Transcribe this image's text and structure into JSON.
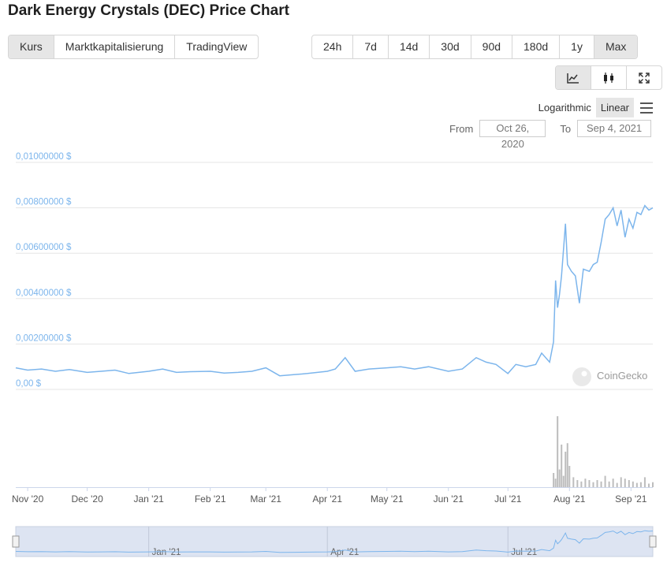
{
  "title": "Dark Energy Crystals (DEC) Price Chart",
  "type_tabs": [
    {
      "label": "Kurs",
      "active": true
    },
    {
      "label": "Marktkapitalisierung",
      "active": false
    },
    {
      "label": "TradingView",
      "active": false
    }
  ],
  "range_tabs": [
    {
      "label": "24h",
      "active": false
    },
    {
      "label": "7d",
      "active": false
    },
    {
      "label": "14d",
      "active": false
    },
    {
      "label": "30d",
      "active": false
    },
    {
      "label": "90d",
      "active": false
    },
    {
      "label": "180d",
      "active": false
    },
    {
      "label": "1y",
      "active": false
    },
    {
      "label": "Max",
      "active": true
    }
  ],
  "tools": [
    {
      "icon": "line-chart-icon",
      "active": true
    },
    {
      "icon": "candlestick-icon",
      "active": false
    },
    {
      "icon": "expand-icon",
      "active": false
    }
  ],
  "scale": {
    "logarithmic": "Logarithmic",
    "linear": "Linear",
    "active": "linear"
  },
  "date_range": {
    "from_label": "From",
    "from": "Oct 26, 2020",
    "to_label": "To",
    "to": "Sep 4, 2021"
  },
  "watermark": "CoinGecko",
  "colors": {
    "line": "#7cb5ec",
    "volume": "#bdbdbd",
    "navigator_fill": "#dde4f2",
    "grid": "#e6e6e6"
  },
  "chart_data": {
    "type": "line",
    "y_ticks": [
      {
        "value": 0.01,
        "label": "0,01000000 $"
      },
      {
        "value": 0.008,
        "label": "0,00800000 $"
      },
      {
        "value": 0.006,
        "label": "0,00600000 $"
      },
      {
        "value": 0.004,
        "label": "0,00400000 $"
      },
      {
        "value": 0.002,
        "label": "0,00200000 $"
      },
      {
        "value": 0,
        "label": "0,00 $"
      }
    ],
    "ylim": [
      0,
      0.01
    ],
    "x_ticks": [
      "Nov '20",
      "Dec '20",
      "Jan '21",
      "Feb '21",
      "Mar '21",
      "Apr '21",
      "May '21",
      "Jun '21",
      "Jul '21",
      "Aug '21",
      "Sep '21"
    ],
    "navigator_ticks": [
      "Jan '21",
      "Apr '21",
      "Jul '21"
    ],
    "series": [
      {
        "values": [
          {
            "x": "2020-10-26",
            "y": 0.00095
          },
          {
            "x": "2020-11-01",
            "y": 0.00085
          },
          {
            "x": "2020-11-08",
            "y": 0.0009
          },
          {
            "x": "2020-11-15",
            "y": 0.0008
          },
          {
            "x": "2020-11-22",
            "y": 0.00088
          },
          {
            "x": "2020-12-01",
            "y": 0.00075
          },
          {
            "x": "2020-12-08",
            "y": 0.0008
          },
          {
            "x": "2020-12-15",
            "y": 0.00085
          },
          {
            "x": "2020-12-22",
            "y": 0.0007
          },
          {
            "x": "2021-01-01",
            "y": 0.0008
          },
          {
            "x": "2021-01-08",
            "y": 0.0009
          },
          {
            "x": "2021-01-15",
            "y": 0.00075
          },
          {
            "x": "2021-01-22",
            "y": 0.00078
          },
          {
            "x": "2021-02-01",
            "y": 0.0008
          },
          {
            "x": "2021-02-08",
            "y": 0.00072
          },
          {
            "x": "2021-02-15",
            "y": 0.00075
          },
          {
            "x": "2021-02-22",
            "y": 0.0008
          },
          {
            "x": "2021-03-01",
            "y": 0.00095
          },
          {
            "x": "2021-03-08",
            "y": 0.0006
          },
          {
            "x": "2021-03-15",
            "y": 0.00065
          },
          {
            "x": "2021-03-22",
            "y": 0.0007
          },
          {
            "x": "2021-04-01",
            "y": 0.0008
          },
          {
            "x": "2021-04-05",
            "y": 0.0009
          },
          {
            "x": "2021-04-10",
            "y": 0.0014
          },
          {
            "x": "2021-04-15",
            "y": 0.0008
          },
          {
            "x": "2021-04-22",
            "y": 0.0009
          },
          {
            "x": "2021-05-01",
            "y": 0.00095
          },
          {
            "x": "2021-05-08",
            "y": 0.001
          },
          {
            "x": "2021-05-15",
            "y": 0.0009
          },
          {
            "x": "2021-05-22",
            "y": 0.001
          },
          {
            "x": "2021-06-01",
            "y": 0.0008
          },
          {
            "x": "2021-06-08",
            "y": 0.0009
          },
          {
            "x": "2021-06-15",
            "y": 0.0014
          },
          {
            "x": "2021-06-20",
            "y": 0.0012
          },
          {
            "x": "2021-06-25",
            "y": 0.0011
          },
          {
            "x": "2021-07-01",
            "y": 0.0007
          },
          {
            "x": "2021-07-05",
            "y": 0.0011
          },
          {
            "x": "2021-07-10",
            "y": 0.001
          },
          {
            "x": "2021-07-15",
            "y": 0.0011
          },
          {
            "x": "2021-07-18",
            "y": 0.0016
          },
          {
            "x": "2021-07-22",
            "y": 0.0012
          },
          {
            "x": "2021-07-24",
            "y": 0.0021
          },
          {
            "x": "2021-07-25",
            "y": 0.0048
          },
          {
            "x": "2021-07-26",
            "y": 0.0036
          },
          {
            "x": "2021-07-27",
            "y": 0.0042
          },
          {
            "x": "2021-07-28",
            "y": 0.005
          },
          {
            "x": "2021-07-30",
            "y": 0.0073
          },
          {
            "x": "2021-07-31",
            "y": 0.0055
          },
          {
            "x": "2021-08-02",
            "y": 0.0052
          },
          {
            "x": "2021-08-04",
            "y": 0.005
          },
          {
            "x": "2021-08-06",
            "y": 0.0038
          },
          {
            "x": "2021-08-08",
            "y": 0.0053
          },
          {
            "x": "2021-08-11",
            "y": 0.0052
          },
          {
            "x": "2021-08-13",
            "y": 0.0055
          },
          {
            "x": "2021-08-15",
            "y": 0.0056
          },
          {
            "x": "2021-08-17",
            "y": 0.0065
          },
          {
            "x": "2021-08-19",
            "y": 0.0075
          },
          {
            "x": "2021-08-21",
            "y": 0.0077
          },
          {
            "x": "2021-08-23",
            "y": 0.008
          },
          {
            "x": "2021-08-25",
            "y": 0.0072
          },
          {
            "x": "2021-08-27",
            "y": 0.0079
          },
          {
            "x": "2021-08-29",
            "y": 0.0067
          },
          {
            "x": "2021-08-31",
            "y": 0.0075
          },
          {
            "x": "2021-09-02",
            "y": 0.0071
          },
          {
            "x": "2021-09-04",
            "y": 0.0078
          },
          {
            "x": "2021-09-06",
            "y": 0.0077
          },
          {
            "x": "2021-09-08",
            "y": 0.0081
          },
          {
            "x": "2021-09-10",
            "y": 0.0079
          },
          {
            "x": "2021-09-12",
            "y": 0.008
          }
        ]
      }
    ],
    "volume": [
      {
        "x": "2021-07-24",
        "v": 0.2
      },
      {
        "x": "2021-07-25",
        "v": 0.12
      },
      {
        "x": "2021-07-26",
        "v": 1.0
      },
      {
        "x": "2021-07-27",
        "v": 0.25
      },
      {
        "x": "2021-07-28",
        "v": 0.6
      },
      {
        "x": "2021-07-29",
        "v": 0.16
      },
      {
        "x": "2021-07-30",
        "v": 0.5
      },
      {
        "x": "2021-07-31",
        "v": 0.62
      },
      {
        "x": "2021-08-01",
        "v": 0.3
      },
      {
        "x": "2021-08-03",
        "v": 0.14
      },
      {
        "x": "2021-08-05",
        "v": 0.1
      },
      {
        "x": "2021-08-07",
        "v": 0.08
      },
      {
        "x": "2021-08-09",
        "v": 0.12
      },
      {
        "x": "2021-08-11",
        "v": 0.1
      },
      {
        "x": "2021-08-13",
        "v": 0.07
      },
      {
        "x": "2021-08-15",
        "v": 0.1
      },
      {
        "x": "2021-08-17",
        "v": 0.08
      },
      {
        "x": "2021-08-19",
        "v": 0.16
      },
      {
        "x": "2021-08-21",
        "v": 0.08
      },
      {
        "x": "2021-08-23",
        "v": 0.12
      },
      {
        "x": "2021-08-25",
        "v": 0.06
      },
      {
        "x": "2021-08-27",
        "v": 0.14
      },
      {
        "x": "2021-08-29",
        "v": 0.12
      },
      {
        "x": "2021-08-31",
        "v": 0.1
      },
      {
        "x": "2021-09-02",
        "v": 0.08
      },
      {
        "x": "2021-09-04",
        "v": 0.06
      },
      {
        "x": "2021-09-06",
        "v": 0.07
      },
      {
        "x": "2021-09-08",
        "v": 0.14
      },
      {
        "x": "2021-09-10",
        "v": 0.05
      },
      {
        "x": "2021-09-12",
        "v": 0.07
      }
    ],
    "grid": true
  }
}
